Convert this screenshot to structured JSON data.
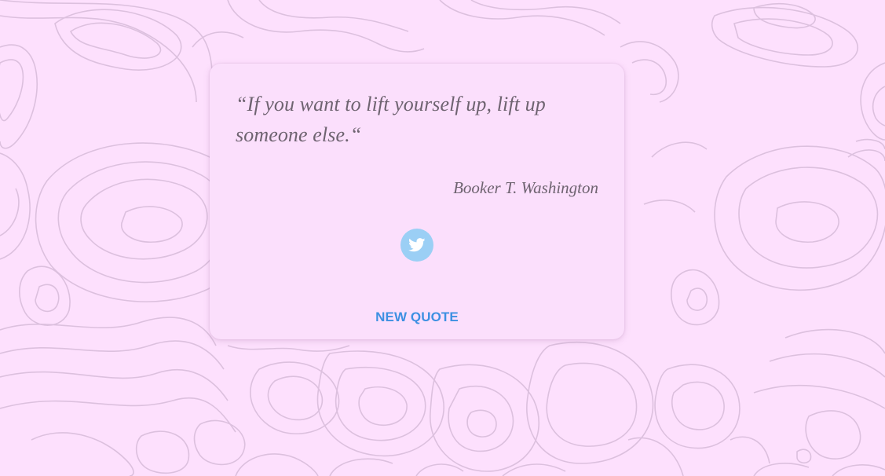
{
  "quote": {
    "text": "“If you want to lift yourself up, lift up someone else.“",
    "author": "Booker T. Washington"
  },
  "share": {
    "icon": "twitter-icon"
  },
  "actions": {
    "new_quote_label": "NEW QUOTE"
  },
  "colors": {
    "background": "#fde0fd",
    "card": "#fbdffc",
    "contour_lines": "#dcc0de",
    "quote_text": "#6e6370",
    "twitter_button": "#9bcff5",
    "accent": "#3e90e2"
  }
}
